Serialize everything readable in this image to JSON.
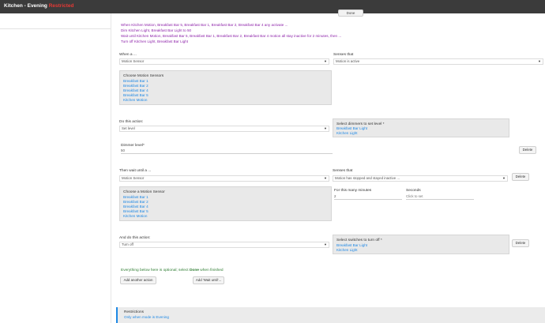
{
  "app": {
    "title_prefix": "Kitchen - Evening",
    "title_state": "Restricted"
  },
  "done_button": "Done",
  "summary": [
    "When Kitchen Motion, Breakfast Bar 5, Breakfast Bar 1, Breakfast Bar 2, Breakfast Bar 4 any activate ...",
    "Dim Kitchen Light, Breakfast Bar Light to 50",
    "Wait until Kitchen Motion, Breakfast Bar 5, Breakfast Bar 1, Breakfast Bar 2, Breakfast Bar 4 motion all stay inactive for 2 minutes, then ...",
    "Turn off Kitchen Light, Breakfast Bar Light"
  ],
  "when": {
    "label": "When a ...",
    "select": "Motion Sensor",
    "senses_label": "Senses that",
    "senses_select": "Motion is active",
    "list_header": "Choose Motion Sensors",
    "list_items": [
      "Breakfast Bar 1",
      "Breakfast Bar 2",
      "Breakfast Bar 4",
      "Breakfast Bar 5",
      "Kitchen Motion"
    ]
  },
  "action1": {
    "label": "Do this action:",
    "select": "Set level",
    "dimmers_header": "Select dimmers to set level *",
    "dimmers_items": [
      "Breakfast Bar Light",
      "Kitchen Light"
    ],
    "dimmer_level_label": "Dimmer level*",
    "dimmer_level_value": "50",
    "delete_label": "Delete"
  },
  "wait": {
    "label": "Then wait until a ...",
    "select": "Motion Sensor",
    "senses_label": "Senses that",
    "senses_select": "Motion has stopped and stayed inactive ...",
    "delete_label": "Delete",
    "list_header": "Choose a Motion Sensor",
    "list_items": [
      "Breakfast Bar 1",
      "Breakfast Bar 2",
      "Breakfast Bar 4",
      "Breakfast Bar 5",
      "Kitchen Motion"
    ],
    "minutes_label": "For this many minutes",
    "minutes_value": "2",
    "seconds_label": "Seconds",
    "seconds_placeholder": "Click to set"
  },
  "action2": {
    "label": "And do this action:",
    "select": "Turn off",
    "switches_header": "Select switches to turn off *",
    "switches_items": [
      "Breakfast Bar Light",
      "Kitchen Light"
    ],
    "delete_label": "Delete"
  },
  "optional": {
    "text_before": "Everything below here is optional; select ",
    "text_bold": "Done",
    "text_after": " when finished"
  },
  "buttons": {
    "add_action": "Add another action",
    "add_wait": "Add 'Wait until'..."
  },
  "restrictions": {
    "title": "Restrictions",
    "value": "Only when mode is Evening"
  }
}
